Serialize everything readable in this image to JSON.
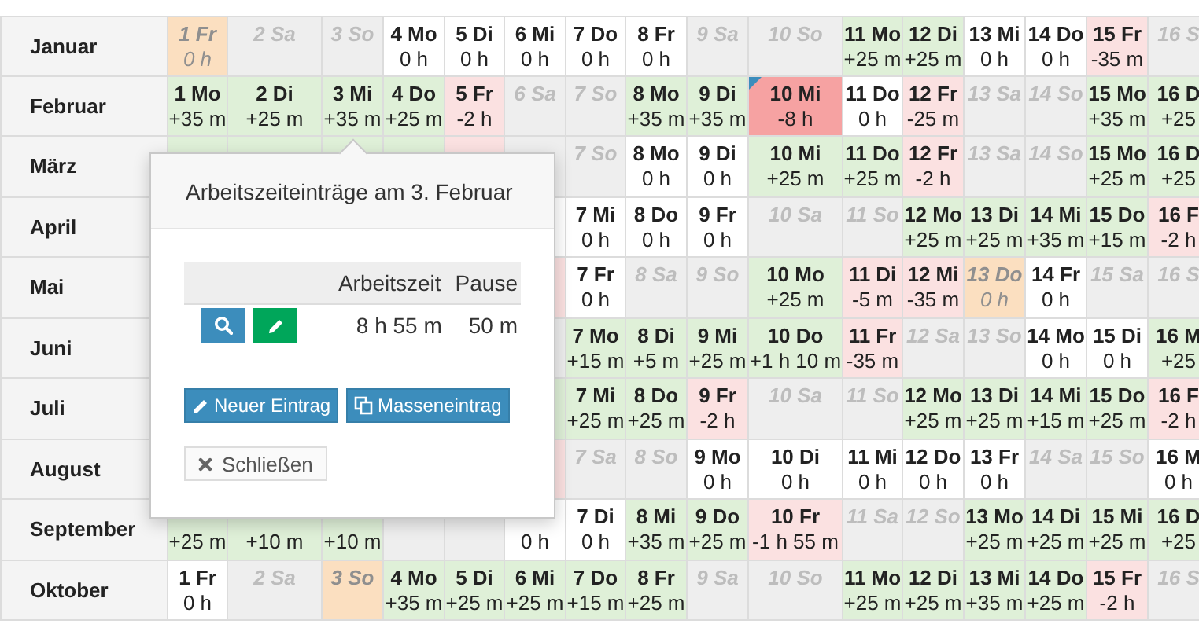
{
  "months": [
    {
      "name": "Januar",
      "cells": [
        {
          "kind": "holiday",
          "label": "1 Fr",
          "value": "0 h"
        },
        {
          "kind": "weekend",
          "label": "2 Sa"
        },
        {
          "kind": "weekend",
          "label": "3 So"
        },
        {
          "kind": "zero",
          "label": "4 Mo",
          "value": "0 h"
        },
        {
          "kind": "zero",
          "label": "5 Di",
          "value": "0 h"
        },
        {
          "kind": "zero",
          "label": "6 Mi",
          "value": "0 h"
        },
        {
          "kind": "zero",
          "label": "7 Do",
          "value": "0 h"
        },
        {
          "kind": "zero",
          "label": "8 Fr",
          "value": "0 h"
        },
        {
          "kind": "weekend",
          "label": "9 Sa"
        },
        {
          "kind": "weekend",
          "label": "10 So"
        },
        {
          "kind": "plus",
          "label": "11 Mo",
          "value": "+25 m"
        },
        {
          "kind": "plus",
          "label": "12 Di",
          "value": "+25 m"
        },
        {
          "kind": "zero",
          "label": "13 Mi",
          "value": "0 h"
        },
        {
          "kind": "zero",
          "label": "14 Do",
          "value": "0 h"
        },
        {
          "kind": "minus",
          "label": "15 Fr",
          "value": "-35 m"
        },
        {
          "kind": "weekend",
          "label": "16 S"
        }
      ]
    },
    {
      "name": "Februar",
      "cells": [
        {
          "kind": "plus",
          "label": "1 Mo",
          "value": "+35 m"
        },
        {
          "kind": "plus",
          "label": "2 Di",
          "value": "+25 m"
        },
        {
          "kind": "plus",
          "label": "3 Mi",
          "value": "+35 m"
        },
        {
          "kind": "plus",
          "label": "4 Do",
          "value": "+25 m"
        },
        {
          "kind": "minus",
          "label": "5 Fr",
          "value": "-2 h"
        },
        {
          "kind": "weekend",
          "label": "6 Sa"
        },
        {
          "kind": "weekend",
          "label": "7 So"
        },
        {
          "kind": "plus",
          "label": "8 Mo",
          "value": "+35 m"
        },
        {
          "kind": "plus",
          "label": "9 Di",
          "value": "+35 m"
        },
        {
          "kind": "absent",
          "label": "10 Mi",
          "value": "-8 h"
        },
        {
          "kind": "zero",
          "label": "11 Do",
          "value": "0 h"
        },
        {
          "kind": "minus",
          "label": "12 Fr",
          "value": "-25 m"
        },
        {
          "kind": "weekend",
          "label": "13 Sa"
        },
        {
          "kind": "weekend",
          "label": "14 So"
        },
        {
          "kind": "plus",
          "label": "15 Mo",
          "value": "+35 m"
        },
        {
          "kind": "plus",
          "label": "16 D",
          "value": "+25"
        }
      ]
    },
    {
      "name": "März",
      "cells": [
        {
          "kind": "plus"
        },
        {
          "kind": "plus"
        },
        {
          "kind": "plus"
        },
        {
          "kind": "plus"
        },
        {
          "kind": "minus"
        },
        {
          "kind": "weekend"
        },
        {
          "kind": "weekend",
          "label": "7 So"
        },
        {
          "kind": "zero",
          "label": "8 Mo",
          "value": "0 h"
        },
        {
          "kind": "zero",
          "label": "9 Di",
          "value": "0 h"
        },
        {
          "kind": "plus",
          "label": "10 Mi",
          "value": "+25 m"
        },
        {
          "kind": "plus",
          "label": "11 Do",
          "value": "+25 m"
        },
        {
          "kind": "minus",
          "label": "12 Fr",
          "value": "-2 h"
        },
        {
          "kind": "weekend",
          "label": "13 Sa"
        },
        {
          "kind": "weekend",
          "label": "14 So"
        },
        {
          "kind": "plus",
          "label": "15 Mo",
          "value": "+25 m"
        },
        {
          "kind": "plus",
          "label": "16 D",
          "value": "+25"
        }
      ]
    },
    {
      "name": "April",
      "cells": [
        {
          "kind": "hidden"
        },
        {
          "kind": "hidden"
        },
        {
          "kind": "hidden"
        },
        {
          "kind": "hidden"
        },
        {
          "kind": "hidden"
        },
        {
          "kind": "zero"
        },
        {
          "kind": "zero",
          "label": "7 Mi",
          "value": "0 h"
        },
        {
          "kind": "zero",
          "label": "8 Do",
          "value": "0 h"
        },
        {
          "kind": "zero",
          "label": "9 Fr",
          "value": "0 h"
        },
        {
          "kind": "weekend",
          "label": "10 Sa"
        },
        {
          "kind": "weekend",
          "label": "11 So"
        },
        {
          "kind": "plus",
          "label": "12 Mo",
          "value": "+25 m"
        },
        {
          "kind": "plus",
          "label": "13 Di",
          "value": "+25 m"
        },
        {
          "kind": "plus",
          "label": "14 Mi",
          "value": "+35 m"
        },
        {
          "kind": "plus",
          "label": "15 Do",
          "value": "+15 m"
        },
        {
          "kind": "minus",
          "label": "16 F",
          "value": "-2 h"
        }
      ]
    },
    {
      "name": "Mai",
      "cells": [
        {
          "kind": "hidden"
        },
        {
          "kind": "hidden"
        },
        {
          "kind": "hidden"
        },
        {
          "kind": "hidden"
        },
        {
          "kind": "hidden"
        },
        {
          "kind": "minus"
        },
        {
          "kind": "zero",
          "label": "7 Fr",
          "value": "0 h"
        },
        {
          "kind": "weekend",
          "label": "8 Sa"
        },
        {
          "kind": "weekend",
          "label": "9 So"
        },
        {
          "kind": "plus",
          "label": "10 Mo",
          "value": "+25 m"
        },
        {
          "kind": "minus",
          "label": "11 Di",
          "value": "-5 m"
        },
        {
          "kind": "minus",
          "label": "12 Mi",
          "value": "-35 m"
        },
        {
          "kind": "holiday",
          "label": "13 Do",
          "value": "0 h"
        },
        {
          "kind": "zero",
          "label": "14 Fr",
          "value": "0 h"
        },
        {
          "kind": "weekend",
          "label": "15 Sa"
        },
        {
          "kind": "weekend",
          "label": "16 S"
        }
      ]
    },
    {
      "name": "Juni",
      "cells": [
        {
          "kind": "hidden"
        },
        {
          "kind": "hidden"
        },
        {
          "kind": "hidden"
        },
        {
          "kind": "hidden"
        },
        {
          "kind": "hidden"
        },
        {
          "kind": "weekend"
        },
        {
          "kind": "plus",
          "label": "7 Mo",
          "value": "+15 m"
        },
        {
          "kind": "plus",
          "label": "8 Di",
          "value": "+5 m"
        },
        {
          "kind": "plus",
          "label": "9 Mi",
          "value": "+25 m"
        },
        {
          "kind": "plus",
          "label": "10 Do",
          "value": "+1 h 10 m"
        },
        {
          "kind": "minus",
          "label": "11 Fr",
          "value": "-35 m"
        },
        {
          "kind": "weekend",
          "label": "12 Sa"
        },
        {
          "kind": "weekend",
          "label": "13 So"
        },
        {
          "kind": "zero",
          "label": "14 Mo",
          "value": "0 h"
        },
        {
          "kind": "zero",
          "label": "15 Di",
          "value": "0 h"
        },
        {
          "kind": "plus",
          "label": "16 M",
          "value": "+25"
        }
      ]
    },
    {
      "name": "Juli",
      "cells": [
        {
          "kind": "hidden"
        },
        {
          "kind": "hidden"
        },
        {
          "kind": "hidden"
        },
        {
          "kind": "hidden"
        },
        {
          "kind": "hidden"
        },
        {
          "kind": "plus"
        },
        {
          "kind": "plus",
          "label": "7 Mi",
          "value": "+25 m"
        },
        {
          "kind": "plus",
          "label": "8 Do",
          "value": "+25 m"
        },
        {
          "kind": "minus",
          "label": "9 Fr",
          "value": "-2 h"
        },
        {
          "kind": "weekend",
          "label": "10 Sa"
        },
        {
          "kind": "weekend",
          "label": "11 So"
        },
        {
          "kind": "plus",
          "label": "12 Mo",
          "value": "+25 m"
        },
        {
          "kind": "plus",
          "label": "13 Di",
          "value": "+25 m"
        },
        {
          "kind": "plus",
          "label": "14 Mi",
          "value": "+15 m"
        },
        {
          "kind": "plus",
          "label": "15 Do",
          "value": "+25 m"
        },
        {
          "kind": "minus",
          "label": "16 F",
          "value": "-2 h"
        }
      ]
    },
    {
      "name": "August",
      "cells": [
        {
          "kind": "hidden"
        },
        {
          "kind": "hidden"
        },
        {
          "kind": "hidden"
        },
        {
          "kind": "hidden"
        },
        {
          "kind": "hidden"
        },
        {
          "kind": "minus"
        },
        {
          "kind": "weekend",
          "label": "7 Sa"
        },
        {
          "kind": "weekend",
          "label": "8 So"
        },
        {
          "kind": "zero",
          "label": "9 Mo",
          "value": "0 h"
        },
        {
          "kind": "zero",
          "label": "10 Di",
          "value": "0 h"
        },
        {
          "kind": "zero",
          "label": "11 Mi",
          "value": "0 h"
        },
        {
          "kind": "zero",
          "label": "12 Do",
          "value": "0 h"
        },
        {
          "kind": "zero",
          "label": "13 Fr",
          "value": "0 h"
        },
        {
          "kind": "weekend",
          "label": "14 Sa"
        },
        {
          "kind": "weekend",
          "label": "15 So"
        },
        {
          "kind": "zero",
          "label": "16 M",
          "value": "0 h"
        }
      ]
    },
    {
      "name": "September",
      "cells": [
        {
          "kind": "plus",
          "value": "+25 m"
        },
        {
          "kind": "plus",
          "value": "+10 m"
        },
        {
          "kind": "plus",
          "value": "+10 m"
        },
        {
          "kind": "weekend"
        },
        {
          "kind": "weekend"
        },
        {
          "kind": "zero",
          "value": "0 h"
        },
        {
          "kind": "zero",
          "label": "7 Di",
          "value": "0 h"
        },
        {
          "kind": "plus",
          "label": "8 Mi",
          "value": "+35 m"
        },
        {
          "kind": "plus",
          "label": "9 Do",
          "value": "+25 m"
        },
        {
          "kind": "minus",
          "label": "10 Fr",
          "value": "-1 h 55 m"
        },
        {
          "kind": "weekend",
          "label": "11 Sa"
        },
        {
          "kind": "weekend",
          "label": "12 So"
        },
        {
          "kind": "plus",
          "label": "13 Mo",
          "value": "+25 m"
        },
        {
          "kind": "plus",
          "label": "14 Di",
          "value": "+25 m"
        },
        {
          "kind": "plus",
          "label": "15 Mi",
          "value": "+25 m"
        },
        {
          "kind": "plus",
          "label": "16 D",
          "value": "+25"
        }
      ]
    },
    {
      "name": "Oktober",
      "cells": [
        {
          "kind": "zero",
          "label": "1 Fr",
          "value": "0 h"
        },
        {
          "kind": "weekend",
          "label": "2 Sa"
        },
        {
          "kind": "holiday",
          "label": "3 So"
        },
        {
          "kind": "plus",
          "label": "4 Mo",
          "value": "+35 m"
        },
        {
          "kind": "plus",
          "label": "5 Di",
          "value": "+25 m"
        },
        {
          "kind": "plus",
          "label": "6 Mi",
          "value": "+25 m"
        },
        {
          "kind": "plus",
          "label": "7 Do",
          "value": "+15 m"
        },
        {
          "kind": "plus",
          "label": "8 Fr",
          "value": "+25 m"
        },
        {
          "kind": "weekend",
          "label": "9 Sa"
        },
        {
          "kind": "weekend",
          "label": "10 So"
        },
        {
          "kind": "plus",
          "label": "11 Mo",
          "value": "+25 m"
        },
        {
          "kind": "plus",
          "label": "12 Di",
          "value": "+25 m"
        },
        {
          "kind": "plus",
          "label": "13 Mi",
          "value": "+35 m"
        },
        {
          "kind": "plus",
          "label": "14 Do",
          "value": "+25 m"
        },
        {
          "kind": "minus",
          "label": "15 Fr",
          "value": "-2 h"
        },
        {
          "kind": "weekend",
          "label": "16 S"
        }
      ]
    }
  ],
  "popover": {
    "title": "Arbeitszeiteinträge am 3. Februar",
    "columns": [
      "Arbeitszeit",
      "Pause"
    ],
    "entries": [
      {
        "work_time": "8 h 55 m",
        "pause": "50 m"
      }
    ],
    "actions": [
      {
        "kind": "new",
        "label": "Neuer Eintrag"
      },
      {
        "kind": "bulk",
        "label": "Masseneintrag"
      }
    ],
    "close": "Schließen"
  }
}
